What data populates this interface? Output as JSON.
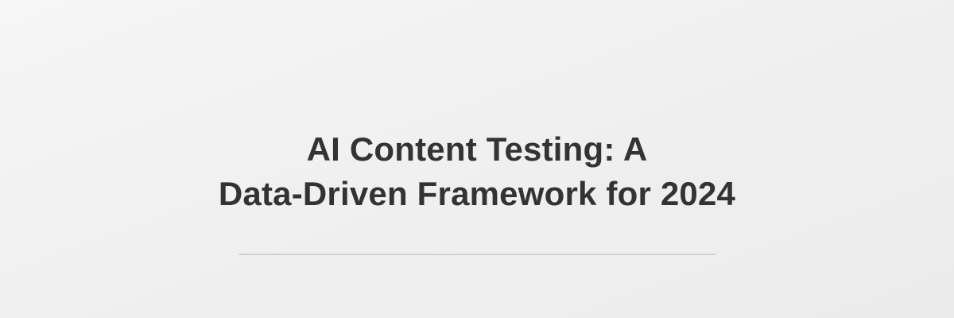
{
  "banner": {
    "title_line_1": "AI Content Testing: A",
    "title_line_2": "Data-Driven Framework for 2024"
  },
  "colors": {
    "background": "#f0f0f0",
    "title_text": "#333333",
    "divider": "#d2d2d2"
  }
}
